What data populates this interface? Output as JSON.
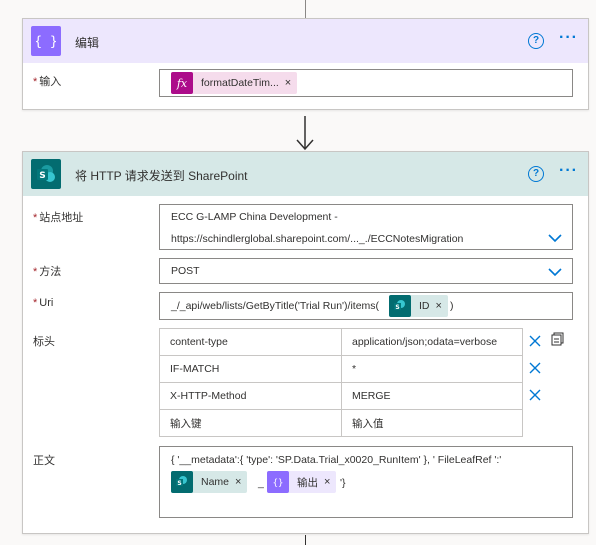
{
  "compose": {
    "title": "编辑",
    "icon": "curly-braces-icon",
    "input_label": "输入",
    "token_label": "formatDateTim...",
    "token_icon": "fx-icon"
  },
  "connector_icon": "arrow-down-icon",
  "sharepoint": {
    "title": "将 HTTP 请求发送到 SharePoint",
    "icon": "sharepoint-icon",
    "site_label": "站点地址",
    "site_line1": "ECC G-LAMP China Development -",
    "site_line2": "https://schindlerglobal.sharepoint.com/..._./ECCNotesMigration",
    "method_label": "方法",
    "method_value": "POST",
    "uri_label": "Uri",
    "uri_prefix": "_/_api/web/lists/GetByTitle('Trial Run')/items(",
    "uri_token": "ID",
    "uri_suffix": ")",
    "headers_label": "标头",
    "headers": [
      {
        "key": "content-type",
        "value": "application/json;odata=verbose"
      },
      {
        "key": "IF-MATCH",
        "value": "*"
      },
      {
        "key": "X-HTTP-Method",
        "value": "MERGE"
      }
    ],
    "header_key_placeholder": "输入键",
    "header_value_placeholder": "输入值",
    "body_label": "正文",
    "body_line1": "{ '__metadata':{ 'type': 'SP.Data.Trial_x0020_RunItem' }, ' FileLeafRef ':'",
    "body_token1": "Name",
    "body_sep": "_",
    "body_token2": "输出",
    "body_end": "'}"
  },
  "colors": {
    "compose_header": "#ede7fd",
    "compose_icon": "#8c6cff",
    "sp_header": "#d6e8e7",
    "sp_icon": "#036c70",
    "accent": "#0078d4",
    "fx": "#ac0c8a"
  }
}
